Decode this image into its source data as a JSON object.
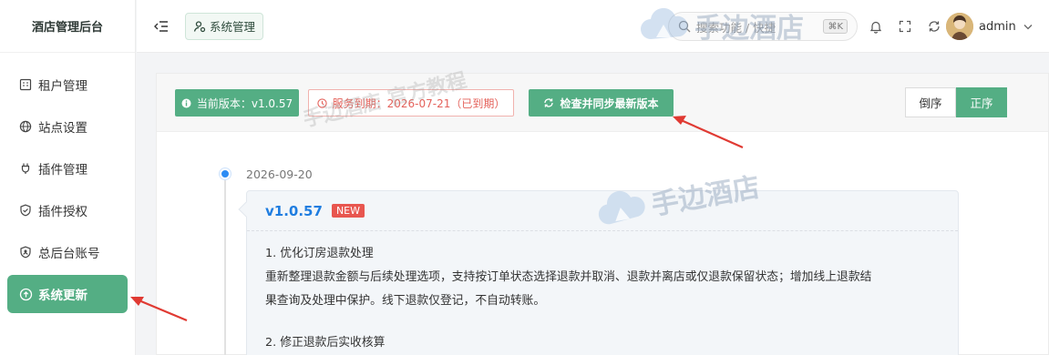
{
  "sidebar": {
    "brand": "酒店管理后台",
    "items": [
      {
        "label": "租户管理",
        "icon": "building-icon"
      },
      {
        "label": "站点设置",
        "icon": "globe-icon"
      },
      {
        "label": "插件管理",
        "icon": "plug-icon"
      },
      {
        "label": "插件授权",
        "icon": "shield-check-icon"
      },
      {
        "label": "总后台账号",
        "icon": "shield-user-icon"
      },
      {
        "label": "系统更新",
        "icon": "cloud-upload-icon",
        "active": true
      }
    ]
  },
  "header": {
    "breadcrumb": "系统管理",
    "search_placeholder": "搜索功能 / 快捷",
    "search_shortcut": "⌘K",
    "username": "admin"
  },
  "toolbar": {
    "version_label": "当前版本：v1.0.57",
    "service_label": "服务到期：2026-07-21（已到期）",
    "check_label": "检查并同步最新版本",
    "sort_desc": "倒序",
    "sort_asc": "正序",
    "active_sort": "正序"
  },
  "timeline": [
    {
      "date": "2026-09-20",
      "version": "v1.0.57",
      "badge": "NEW",
      "lines": [
        "1. 优化订房退款处理",
        "重新整理退款金额与后续处理选项，支持按订单状态选择退款并取消、退款并离店或仅退款保留状态；增加线上退款结",
        "果查询及处理中保护。线下退款仅登记，不自动转账。",
        "",
        "2. 修正退款后实收核算"
      ]
    }
  ],
  "watermarks": {
    "text1": "手边酒店 官方教程",
    "logo_text": "手边酒店"
  },
  "colors": {
    "accent": "#54ae84",
    "link_blue": "#1f7de0",
    "danger": "#e4615a",
    "dot_blue": "#2c8cf4"
  }
}
